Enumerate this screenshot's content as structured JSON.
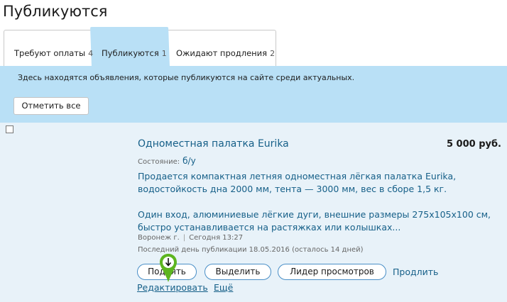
{
  "page": {
    "title": "Публикуются"
  },
  "tabs": [
    {
      "label": "Требуют оплаты",
      "count": "4"
    },
    {
      "label": "Публикуются",
      "count": "1"
    },
    {
      "label": "Ожидают продления",
      "count": "2"
    }
  ],
  "info": {
    "text": "Здесь находятся объявления, которые публикуются на сайте среди актуальных.",
    "mark_all_label": "Отметить все"
  },
  "listing": {
    "title": "Одноместная палатка Eurika",
    "price": "5 000 руб.",
    "condition_label": "Состояние:",
    "condition_value": "б/у",
    "description_1": "Продается компактная летняя одноместная лёгкая палатка Eurika, водостойкость дна 2000 мм, тента — 3000 мм, вес в сборе 1,5 кг.",
    "description_2": "Один вход, алюминиевые лёгкие дуги, внешние размеры 275х105х100 см, быстро устанавливается на растяжках или колышках...",
    "city": "Воронеж г.",
    "date": "Сегодня 13:27",
    "last_day": "Последний день публикации 18.05.2016 (осталось 14 дней)",
    "buttons": {
      "raise": "Поднять",
      "highlight": "Выделить",
      "leader": "Лидер просмотров",
      "extend": "Продлить",
      "edit": "Редактировать",
      "more": "Ещё"
    }
  },
  "colors": {
    "accent_bg": "#b9e0f6",
    "listing_bg": "#e8f2f9",
    "link": "#155f88",
    "marker": "#5db520"
  },
  "icons": {
    "cursor_marker": "map-pin-arrow-down-icon"
  }
}
